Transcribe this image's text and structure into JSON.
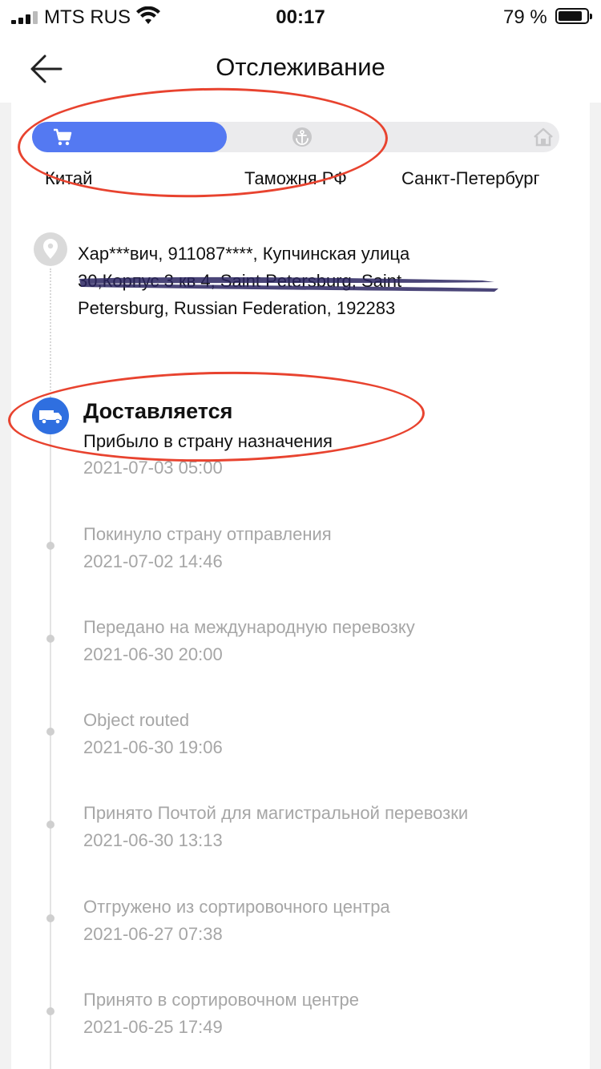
{
  "status_bar": {
    "carrier": "MTS RUS",
    "time": "00:17",
    "battery": "79 %"
  },
  "header": {
    "title": "Отслеживание"
  },
  "progress": {
    "fraction": 0.37,
    "stages": [
      {
        "label": "Китай",
        "icon": "cart-icon"
      },
      {
        "label": "Таможня РФ",
        "icon": "anchor-icon"
      },
      {
        "label": "Санкт-Петербург",
        "icon": "home-icon"
      }
    ],
    "active_color": "#5479f2"
  },
  "address": {
    "line1": "Хар***вич,  911087****,  Купчинская улица",
    "line2": "30,Корпус 3 кв 4,  Saint Petersburg,  Saint",
    "line3": "Petersburg,  Russian Federation,  192283"
  },
  "current_status": {
    "title": "Доставляется",
    "subtitle": "Прибыло в страну назначения",
    "time": "2021-07-03 05:00",
    "icon": "truck-icon",
    "color": "#2f6fe0"
  },
  "events": [
    {
      "text": "Покинуло страну отправления",
      "time": "2021-07-02 14:46"
    },
    {
      "text": "Передано на международную перевозку",
      "time": "2021-06-30 20:00"
    },
    {
      "text": "Object routed",
      "time": "2021-06-30 19:06"
    },
    {
      "text": "Принято Почтой для магистральной перевозки",
      "time": "2021-06-30 13:13"
    },
    {
      "text": "Отгружено из сортировочного центра",
      "time": "2021-06-27 07:38"
    },
    {
      "text": "Принято в сортировочном центре",
      "time": "2021-06-25 17:49"
    }
  ],
  "annotation_color": "#e8432f"
}
